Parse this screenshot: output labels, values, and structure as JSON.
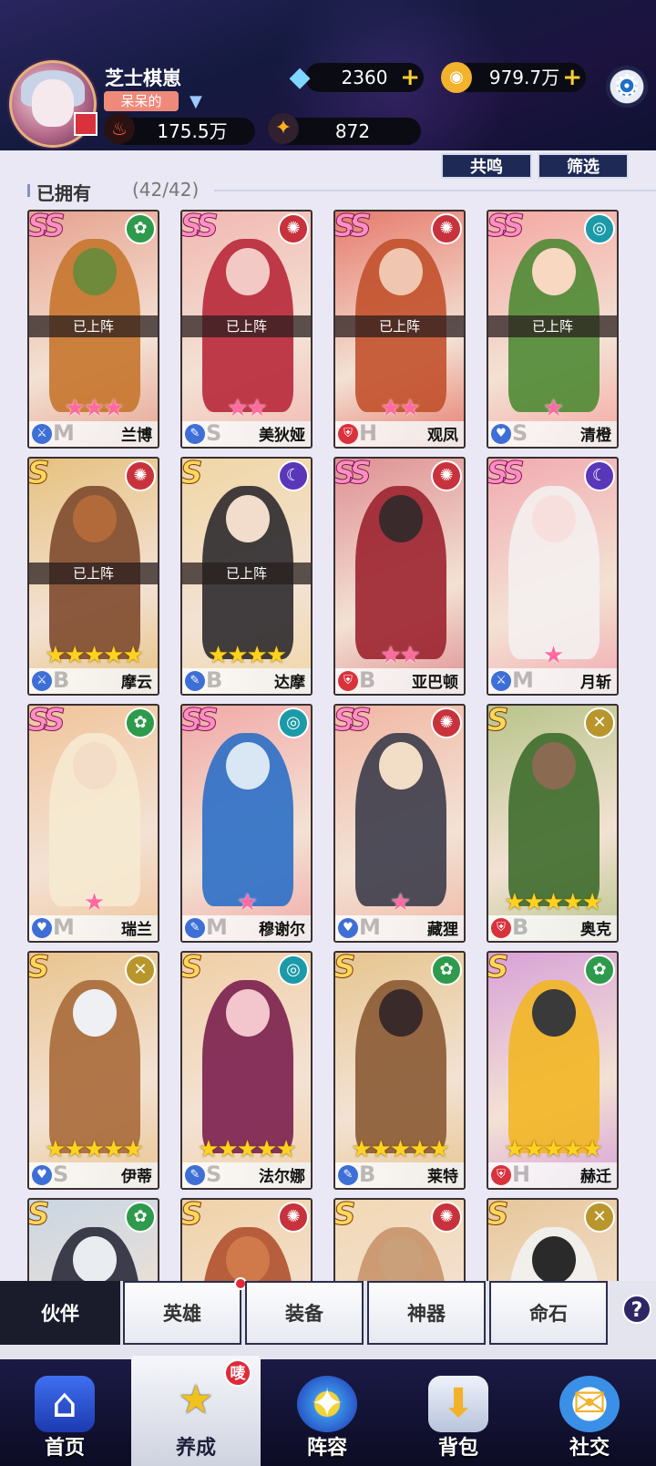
{
  "player": {
    "name": "芝士棋崽",
    "tag": "呆呆的"
  },
  "resources": {
    "diamonds": "2360",
    "gold": "979.7万",
    "power": "175.5万",
    "stars": "872"
  },
  "buttons": {
    "resonance": "共鸣",
    "filter": "筛选"
  },
  "owned": {
    "label": "已拥有",
    "count": "(42/42)"
  },
  "deployed_label": "已上阵",
  "cards": [
    {
      "name": "兰博",
      "rank": "SS",
      "stars": 3,
      "starColor": "pink",
      "deployed": true,
      "elem": "nature",
      "role": "blade",
      "letter": "M",
      "bg": "#e7a28f",
      "fig": "#c7762e",
      "head": "#6f8a3a"
    },
    {
      "name": "美狄娅",
      "rank": "SS",
      "stars": 2,
      "starColor": "pink",
      "deployed": true,
      "elem": "fire",
      "role": "staff",
      "letter": "S",
      "bg": "#f2b8b2",
      "fig": "#b8283a",
      "head": "#f3c9c5"
    },
    {
      "name": "观凤",
      "rank": "SS",
      "stars": 2,
      "starColor": "pink",
      "deployed": true,
      "elem": "fire",
      "role": "shield",
      "letter": "H",
      "bg": "#e67a6c",
      "fig": "#c2512c",
      "head": "#f0c6b0"
    },
    {
      "name": "清橙",
      "rank": "SS",
      "stars": 1,
      "starColor": "pink",
      "deployed": true,
      "elem": "water",
      "role": "heart",
      "letter": "S",
      "bg": "#f4a7a2",
      "fig": "#4f8a34",
      "head": "#f9d8c2"
    },
    {
      "name": "摩云",
      "rank": "S",
      "stars": 5,
      "starColor": "gold",
      "deployed": true,
      "elem": "fire",
      "role": "blade",
      "letter": "B",
      "bg": "#e6c17e",
      "fig": "#7e4a2e",
      "head": "#b26a3a"
    },
    {
      "name": "达摩",
      "rank": "S",
      "stars": 4,
      "starColor": "gold",
      "deployed": true,
      "elem": "dark",
      "role": "staff",
      "letter": "B",
      "bg": "#f0d6a4",
      "fig": "#2e2a2e",
      "head": "#f2dccc"
    },
    {
      "name": "亚巴顿",
      "rank": "SS",
      "stars": 2,
      "starColor": "pink",
      "deployed": false,
      "elem": "fire",
      "role": "shield",
      "letter": "B",
      "bg": "#df8f92",
      "fig": "#9c2330",
      "head": "#3a2a2c"
    },
    {
      "name": "月斩",
      "rank": "SS",
      "stars": 1,
      "starColor": "pink",
      "deployed": false,
      "elem": "dark",
      "role": "blade",
      "letter": "M",
      "bg": "#f2aab0",
      "fig": "#f4f0f0",
      "head": "#f6dfdc"
    },
    {
      "name": "瑞兰",
      "rank": "SS",
      "stars": 1,
      "starColor": "pink",
      "deployed": false,
      "elem": "nature",
      "role": "heart",
      "letter": "M",
      "bg": "#f0c49a",
      "fig": "#f6ead2",
      "head": "#f3dcc8"
    },
    {
      "name": "穆谢尔",
      "rank": "SS",
      "stars": 1,
      "starColor": "pink",
      "deployed": false,
      "elem": "water",
      "role": "staff",
      "letter": "M",
      "bg": "#f2a9a7",
      "fig": "#2b6fc7",
      "head": "#d9e6f3"
    },
    {
      "name": "藏狸",
      "rank": "SS",
      "stars": 1,
      "starColor": "pink",
      "deployed": false,
      "elem": "fire",
      "role": "heart",
      "letter": "M",
      "bg": "#f1b7a4",
      "fig": "#3c3c4a",
      "head": "#f2ddc6"
    },
    {
      "name": "奥克",
      "rank": "S",
      "stars": 5,
      "starColor": "gold",
      "deployed": false,
      "elem": "light",
      "role": "shield",
      "letter": "B",
      "bg": "#b7c48a",
      "fig": "#3e6b2c",
      "head": "#8a6a50"
    },
    {
      "name": "伊蒂",
      "rank": "S",
      "stars": 5,
      "starColor": "gold",
      "deployed": false,
      "elem": "light",
      "role": "heart",
      "letter": "S",
      "bg": "#e9c48e",
      "fig": "#a86a3a",
      "head": "#eef0f4"
    },
    {
      "name": "法尔娜",
      "rank": "S",
      "stars": 5,
      "starColor": "gold",
      "deployed": false,
      "elem": "water",
      "role": "staff",
      "letter": "S",
      "bg": "#f0cfa6",
      "fig": "#7a1f4e",
      "head": "#f2c6cc"
    },
    {
      "name": "莱特",
      "rank": "S",
      "stars": 5,
      "starColor": "gold",
      "deployed": false,
      "elem": "nature",
      "role": "staff",
      "letter": "B",
      "bg": "#e6c58e",
      "fig": "#8a5a34",
      "head": "#3a2a2a"
    },
    {
      "name": "赫迁",
      "rank": "S",
      "stars": 5,
      "starColor": "gold",
      "deployed": false,
      "elem": "nature",
      "role": "shield",
      "letter": "H",
      "bg": "#d8a1d8",
      "fig": "#f2b623",
      "head": "#3a3a3a"
    },
    {
      "name": "",
      "rank": "S",
      "stars": 0,
      "starColor": "gold",
      "deployed": false,
      "elem": "nature",
      "role": "blade",
      "letter": "",
      "bg": "#c8d6e4",
      "fig": "#2a2a3a",
      "head": "#e9edf2"
    },
    {
      "name": "",
      "rank": "S",
      "stars": 0,
      "starColor": "gold",
      "deployed": false,
      "elem": "fire",
      "role": "blade",
      "letter": "",
      "bg": "#f0d2a8",
      "fig": "#b0502e",
      "head": "#d07a4c"
    },
    {
      "name": "",
      "rank": "S",
      "stars": 0,
      "starColor": "gold",
      "deployed": false,
      "elem": "fire",
      "role": "blade",
      "letter": "",
      "bg": "#f2d8b4",
      "fig": "#c9946a",
      "head": "#c9a07a"
    },
    {
      "name": "",
      "rank": "S",
      "stars": 0,
      "starColor": "gold",
      "deployed": false,
      "elem": "light",
      "role": "blade",
      "letter": "",
      "bg": "#e7c79a",
      "fig": "#f2f2f2",
      "head": "#2a2a2a"
    }
  ],
  "elemColors": {
    "nature": "#2e9a4c",
    "fire": "#c8323c",
    "water": "#1b9aa8",
    "dark": "#5a36b8",
    "light": "#b8962c"
  },
  "elemGlyphs": {
    "nature": "✿",
    "fire": "✺",
    "water": "◎",
    "dark": "☾",
    "light": "✕"
  },
  "roleColors": {
    "blade": "#3d6fd6",
    "staff": "#3d6fd6",
    "shield": "#d8323c",
    "heart": "#3d6fd6"
  },
  "roleGlyphs": {
    "blade": "⚔",
    "staff": "✎",
    "shield": "⛨",
    "heart": "♥"
  },
  "tabs": [
    "伙伴",
    "英雄",
    "装备",
    "神器",
    "命石"
  ],
  "help": "?",
  "nav": [
    {
      "label": "首页",
      "icon": "home-icon",
      "glyph": "⌂"
    },
    {
      "label": "养成",
      "icon": "cultivate-icon",
      "glyph": "★",
      "badge": "唛"
    },
    {
      "label": "阵容",
      "icon": "formation-icon",
      "glyph": "✦"
    },
    {
      "label": "背包",
      "icon": "bag-icon",
      "glyph": "⬇"
    },
    {
      "label": "社交",
      "icon": "social-icon",
      "glyph": "✉"
    }
  ]
}
